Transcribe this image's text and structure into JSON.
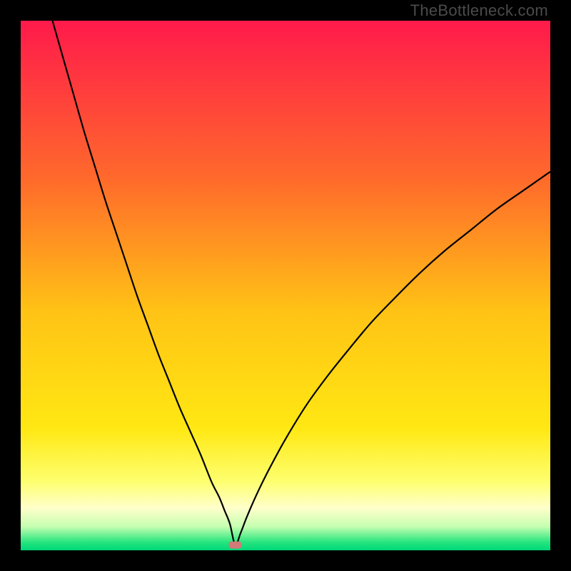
{
  "watermark": "TheBottleneck.com",
  "chart_data": {
    "type": "line",
    "title": "",
    "xlabel": "",
    "ylabel": "",
    "xlim": [
      0,
      100
    ],
    "ylim": [
      0,
      100
    ],
    "background_gradient_stops": [
      {
        "offset": 0.0,
        "color": "#ff1a4b"
      },
      {
        "offset": 0.3,
        "color": "#ff6a2b"
      },
      {
        "offset": 0.55,
        "color": "#ffc315"
      },
      {
        "offset": 0.77,
        "color": "#ffe813"
      },
      {
        "offset": 0.87,
        "color": "#feff6f"
      },
      {
        "offset": 0.92,
        "color": "#ffffcb"
      },
      {
        "offset": 0.955,
        "color": "#c6ffb1"
      },
      {
        "offset": 0.985,
        "color": "#25e57e"
      },
      {
        "offset": 1.0,
        "color": "#00d77a"
      }
    ],
    "marker": {
      "x": 40.5,
      "y": 1.0,
      "color": "#d17a78"
    },
    "series": [
      {
        "name": "curve",
        "color": "#000000",
        "x": [
          6,
          8,
          10,
          12,
          14,
          16,
          18,
          20,
          22,
          24,
          26,
          28,
          30,
          32,
          34,
          36,
          37.5,
          38.5,
          39.5,
          40.5,
          41.5,
          42.5,
          43.5,
          45,
          47,
          50,
          54,
          58,
          62,
          66,
          70,
          75,
          80,
          85,
          90,
          95,
          100
        ],
        "y": [
          100,
          93,
          86,
          79,
          72.5,
          66,
          60,
          54,
          48,
          42.5,
          37,
          32,
          27,
          22.5,
          18,
          13,
          10,
          7.5,
          5,
          1,
          3.2,
          5.8,
          8.2,
          11.5,
          15.5,
          21,
          27.5,
          33,
          38,
          42.8,
          47,
          52,
          56.5,
          60.5,
          64.5,
          68,
          71.5
        ]
      }
    ]
  }
}
